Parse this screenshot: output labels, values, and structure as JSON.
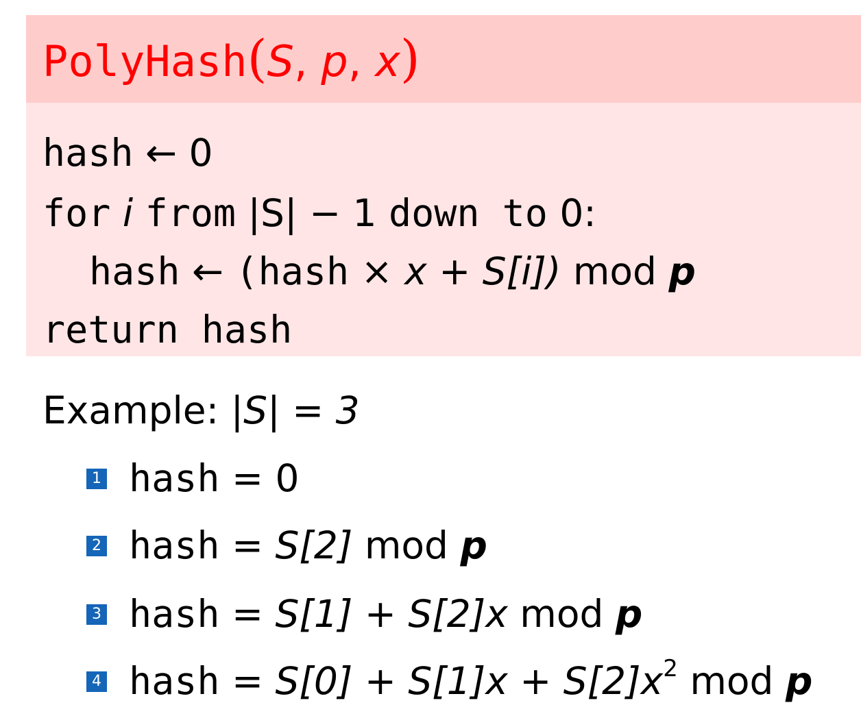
{
  "algorithm": {
    "name": "PolyHash",
    "params": [
      "S",
      "p",
      "x"
    ],
    "lines": [
      {
        "kw": "hash",
        "arrow": "←",
        "rest": "0"
      },
      {
        "kw": "for",
        "var": "i",
        "kw2": "from",
        "range": "|S| − 1",
        "kw3": "down to",
        "end": "0:"
      },
      {
        "kw": "hash",
        "arrow": "←",
        "open": "(hash",
        "times": "×",
        "expr": "x + S[i])",
        "mod": "mod",
        "p": "p"
      },
      {
        "kw": "return hash"
      }
    ]
  },
  "example": {
    "label": "Example:",
    "expr": "|S| = 3"
  },
  "steps": [
    {
      "num": "1",
      "lhs": "hash",
      "eq": "=",
      "rhs": "0"
    },
    {
      "num": "2",
      "lhs": "hash",
      "eq": "=",
      "rhs": "S[2]",
      "mod": "mod",
      "p": "p"
    },
    {
      "num": "3",
      "lhs": "hash",
      "eq": "=",
      "rhs": "S[1] + S[2]x",
      "mod": "mod",
      "p": "p"
    },
    {
      "num": "4",
      "lhs": "hash",
      "eq": "=",
      "rhs": "S[0] + S[1]x + S[2]x",
      "sup": "2",
      "mod": "mod",
      "p": "p"
    }
  ],
  "colors": {
    "title": "#ff0000",
    "header_bg": "#ffcccc",
    "body_bg": "#ffe5e5",
    "bullet": "#1565b8"
  }
}
